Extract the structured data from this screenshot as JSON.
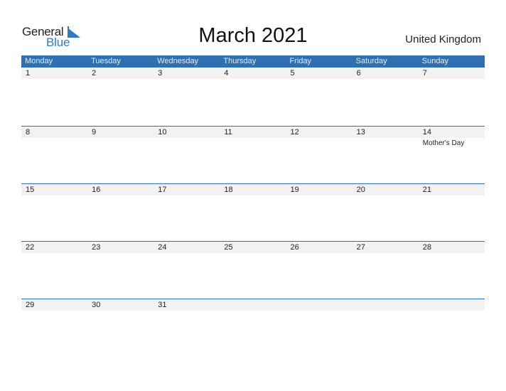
{
  "logo": {
    "text1": "General",
    "text2": "Blue"
  },
  "title": "March 2021",
  "country": "United Kingdom",
  "colors": {
    "accent": "#2e70b1",
    "band": "#f2f2f2"
  },
  "weekdays": [
    "Monday",
    "Tuesday",
    "Wednesday",
    "Thursday",
    "Friday",
    "Saturday",
    "Sunday"
  ],
  "weeks": [
    {
      "days": [
        "1",
        "2",
        "3",
        "4",
        "5",
        "6",
        "7"
      ],
      "events": [
        "",
        "",
        "",
        "",
        "",
        "",
        ""
      ]
    },
    {
      "days": [
        "8",
        "9",
        "10",
        "11",
        "12",
        "13",
        "14"
      ],
      "events": [
        "",
        "",
        "",
        "",
        "",
        "",
        "Mother's Day"
      ]
    },
    {
      "days": [
        "15",
        "16",
        "17",
        "18",
        "19",
        "20",
        "21"
      ],
      "events": [
        "",
        "",
        "",
        "",
        "",
        "",
        ""
      ]
    },
    {
      "days": [
        "22",
        "23",
        "24",
        "25",
        "26",
        "27",
        "28"
      ],
      "events": [
        "",
        "",
        "",
        "",
        "",
        "",
        ""
      ]
    },
    {
      "days": [
        "29",
        "30",
        "31",
        "",
        "",
        "",
        ""
      ],
      "events": [
        "",
        "",
        "",
        "",
        "",
        "",
        ""
      ]
    }
  ]
}
